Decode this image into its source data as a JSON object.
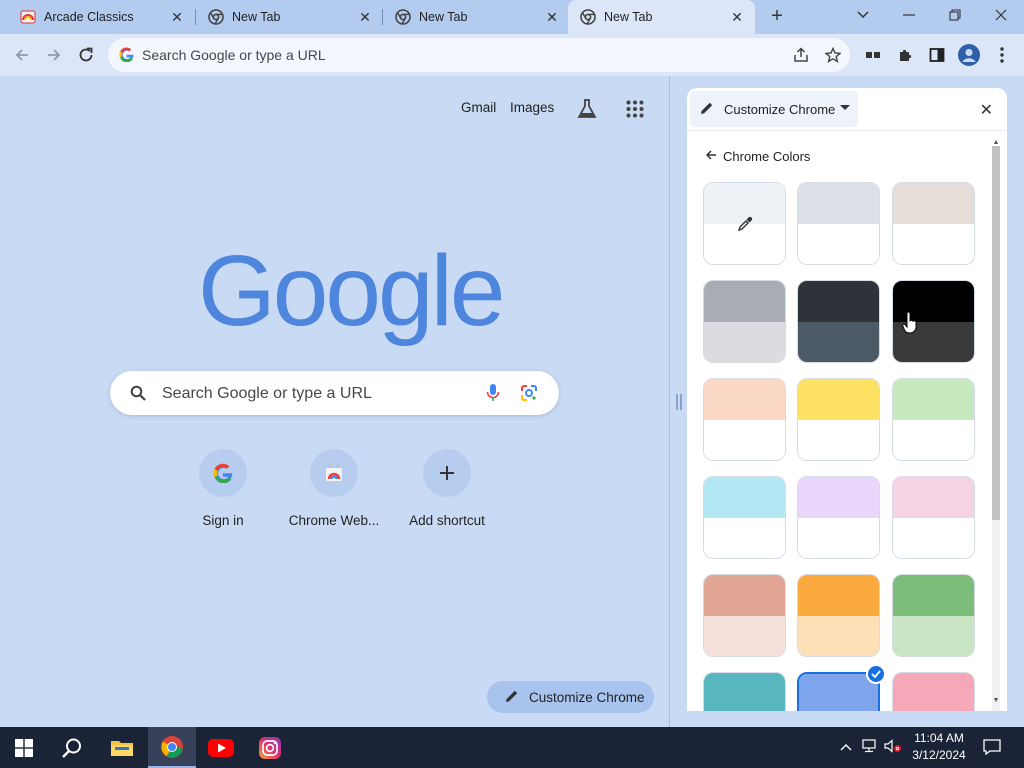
{
  "tabs": [
    {
      "title": "Arcade Classics",
      "active": false
    },
    {
      "title": "New Tab",
      "active": false
    },
    {
      "title": "New Tab",
      "active": false
    },
    {
      "title": "New Tab",
      "active": true
    }
  ],
  "omnibox": {
    "placeholder": "Search Google or type a URL"
  },
  "ntp": {
    "links": {
      "gmail": "Gmail",
      "images": "Images"
    },
    "logo": "Google",
    "search_placeholder": "Search Google or type a URL",
    "shortcuts": [
      {
        "label": "Sign in",
        "icon": "google-g-icon"
      },
      {
        "label": "Chrome Web...",
        "icon": "web-store-icon"
      },
      {
        "label": "Add shortcut",
        "icon": "plus-icon"
      }
    ],
    "customize_button": "Customize Chrome"
  },
  "panel": {
    "dropdown_label": "Customize Chrome",
    "section_title": "Chrome Colors",
    "swatches": [
      {
        "top": "#eef1f5",
        "bottom": "#ffffff",
        "custom": true
      },
      {
        "top": "#dde1e7",
        "bottom": "#ffffff"
      },
      {
        "top": "#e6ddd8",
        "bottom": "#ffffff"
      },
      {
        "top": "#a8acb4",
        "bottom": "#dadce0"
      },
      {
        "top": "#2d3338",
        "bottom": "#4c5a65"
      },
      {
        "top": "#000000",
        "bottom": "#3a3a3a"
      },
      {
        "top": "#fbd8c6",
        "bottom": "#ffffff"
      },
      {
        "top": "#fde163",
        "bottom": "#ffffff"
      },
      {
        "top": "#c7e9c0",
        "bottom": "#ffffff"
      },
      {
        "top": "#b3e7f3",
        "bottom": "#ffffff"
      },
      {
        "top": "#e9d6fb",
        "bottom": "#ffffff"
      },
      {
        "top": "#f6d3e2",
        "bottom": "#ffffff"
      },
      {
        "top": "#e0a593",
        "bottom": "#f5e0db"
      },
      {
        "top": "#fbaa3e",
        "bottom": "#fde0b8"
      },
      {
        "top": "#7dbd7a",
        "bottom": "#c9e6c4"
      },
      {
        "top": "#58b7be",
        "bottom": "#c2e6e8"
      },
      {
        "top": "#7ea5ec",
        "bottom": "#c9dbf6",
        "selected": true
      },
      {
        "top": "#f6a8b8",
        "bottom": "#fbd6de"
      }
    ]
  },
  "taskbar": {
    "time": "11:04 AM",
    "date": "3/12/2024",
    "apps": [
      "windows-start-icon",
      "search-icon",
      "file-explorer-icon",
      "chrome-icon",
      "youtube-icon",
      "instagram-icon"
    ]
  },
  "colors": {
    "accent": "#1a6fe0",
    "page_bg": "#c9dbf4",
    "tabstrip": "#b3cbef"
  }
}
